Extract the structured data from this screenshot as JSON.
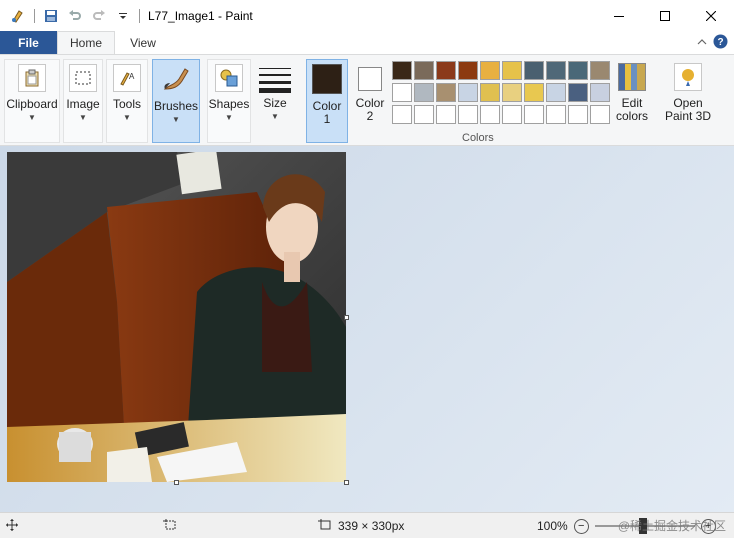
{
  "window": {
    "title": "L77_Image1 - Paint"
  },
  "tabs": {
    "file": "File",
    "home": "Home",
    "view": "View"
  },
  "ribbon": {
    "clipboard": "Clipboard",
    "image": "Image",
    "tools": "Tools",
    "brushes": "Brushes",
    "shapes": "Shapes",
    "size": "Size",
    "color1_line1": "Color",
    "color1_line2": "1",
    "color2_line1": "Color",
    "color2_line2": "2",
    "colors_group": "Colors",
    "edit_colors_line1": "Edit",
    "edit_colors_line2": "colors",
    "open3d_line1": "Open",
    "open3d_line2": "Paint 3D"
  },
  "colors": {
    "color1": "#2d2015",
    "color2": "#ffffff",
    "palette": [
      "#3a2818",
      "#7a6a5a",
      "#8b3a1a",
      "#8c3a10",
      "#e8b040",
      "#e6c24a",
      "#4a6070",
      "#4f6878",
      "#4a6878",
      "#9a8870",
      "#ffffff",
      "#b0b8c0",
      "#a89070",
      "#c8d4e4",
      "#e0c050",
      "#e8d080",
      "#e8c850",
      "#c8d4e4",
      "#4a6080",
      "#c8d0e0",
      "#ffffff",
      "#ffffff",
      "#ffffff",
      "#ffffff",
      "#ffffff",
      "#ffffff",
      "#ffffff",
      "#ffffff",
      "#ffffff",
      "#ffffff"
    ]
  },
  "status": {
    "dimensions": "339 × 330px",
    "zoom": "100%",
    "watermark": "@稀土掘金技术社区"
  }
}
